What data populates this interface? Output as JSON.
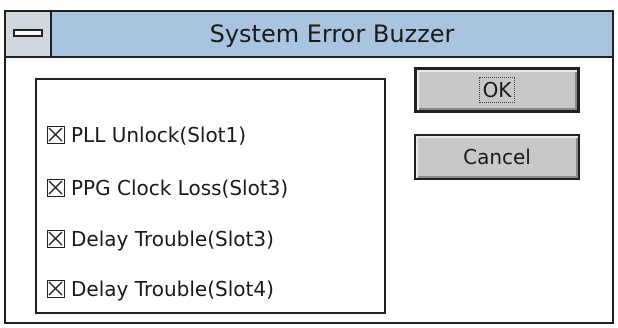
{
  "window": {
    "title": "System Error Buzzer"
  },
  "buttons": {
    "ok_label": "OK",
    "cancel_label": "Cancel"
  },
  "checkboxes": [
    {
      "label": "PLL Unlock(Slot1)",
      "checked": true
    },
    {
      "label": "PPG Clock Loss(Slot3)",
      "checked": true
    },
    {
      "label": "Delay Trouble(Slot3)",
      "checked": true
    },
    {
      "label": "Delay Trouble(Slot4)",
      "checked": true
    }
  ],
  "colors": {
    "titlebar": "#a8c4e0",
    "button": "#c8c8c8"
  }
}
